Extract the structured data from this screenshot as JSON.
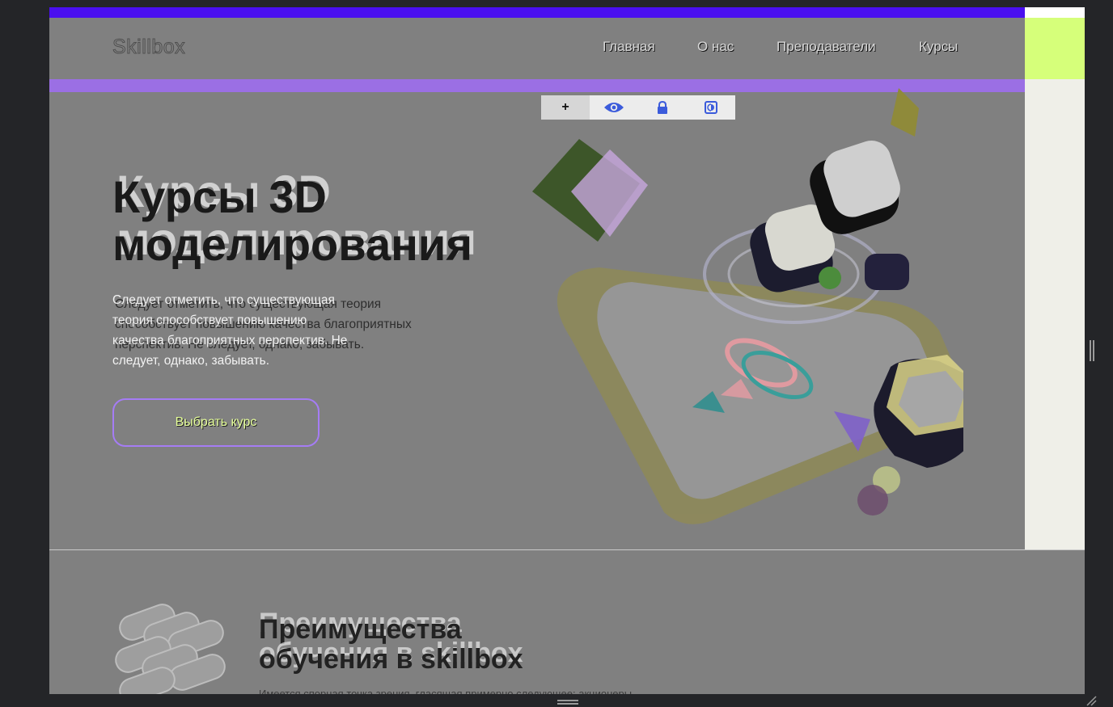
{
  "header": {
    "logo": "Skillbox",
    "nav": [
      "Главная",
      "О нас",
      "Преподаватели",
      "Курсы"
    ]
  },
  "toolbar": {
    "items": [
      {
        "icon": "plus-icon",
        "label": "+"
      },
      {
        "icon": "eye-icon"
      },
      {
        "icon": "lock-icon"
      },
      {
        "icon": "contrast-icon"
      }
    ]
  },
  "hero": {
    "title_line1": "Курсы 3D",
    "title_line2": "моделирования",
    "description": "Следует отметить, что существующая теория способствует повышению качества благоприятных перспектив. Не следует, однако, забывать.",
    "cta_label": "Выбрать курс"
  },
  "section2": {
    "title_line1": "Преимущества",
    "title_line2": "обучения в skillbox",
    "subtitle": "Имеется спорная точка зрения, гласящая примерно следующее: акционеры"
  },
  "colors": {
    "top_bar": "#4a0ff0",
    "accent_purple": "#9b6fe4",
    "accent_lime": "#d6ff7a",
    "cta_border": "#a57cf5",
    "cta_text": "#e6ff9a"
  }
}
